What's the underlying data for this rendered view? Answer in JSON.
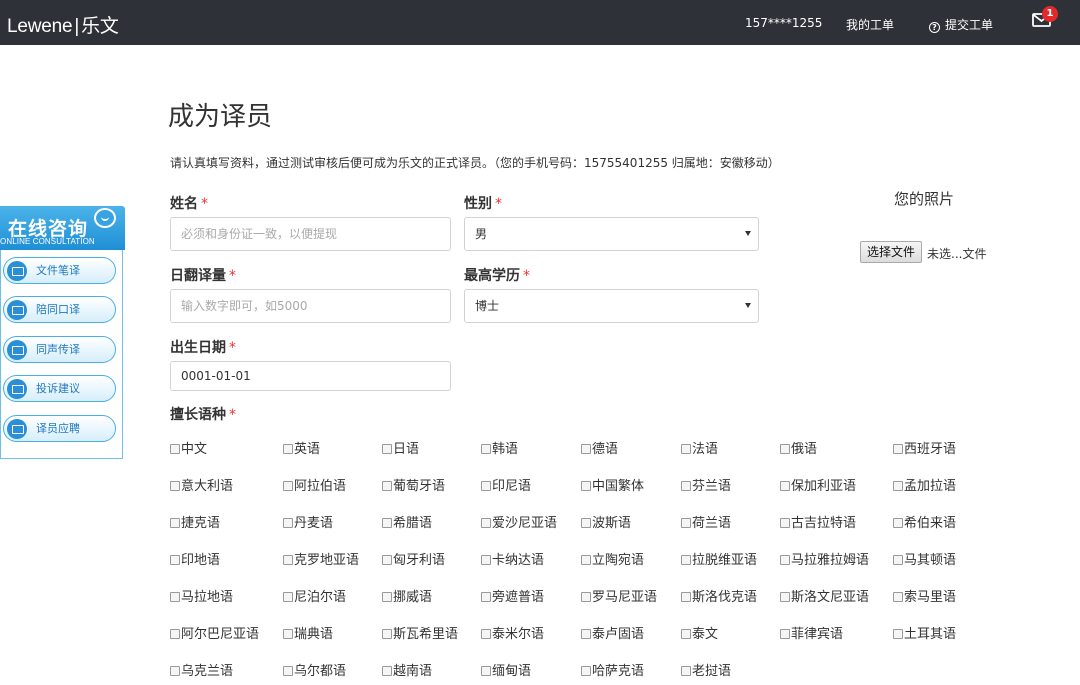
{
  "header": {
    "brand_en": "Lewene",
    "brand_sep": "|",
    "brand_cn": "乐文",
    "phone": "157****1255",
    "my_orders": "我的工单",
    "submit_order": "提交工单",
    "help_icon": "question-circle-icon",
    "mail_icon": "mail-icon",
    "notification_count": "1"
  },
  "page": {
    "title": "成为译员",
    "intro": "请认真填写资料，通过测试审核后便可成为乐文的正式译员。（您的手机号码：15755401255   归属地：安徽移动）"
  },
  "form": {
    "required_mark": "*",
    "name": {
      "label": "姓名",
      "placeholder": "必须和身份证一致，以便提现",
      "value": ""
    },
    "gender": {
      "label": "性别",
      "selected": "男"
    },
    "daily": {
      "label": "日翻译量",
      "placeholder": "输入数字即可，如5000",
      "value": ""
    },
    "education": {
      "label": "最高学历",
      "selected": "博士"
    },
    "birth": {
      "label": "出生日期",
      "value": "0001-01-01"
    },
    "languages_label": "擅长语种",
    "photo": {
      "title": "您的照片",
      "button": "选择文件",
      "status": "未选...文件"
    }
  },
  "languages": [
    "中文",
    "英语",
    "日语",
    "韩语",
    "德语",
    "法语",
    "俄语",
    "西班牙语",
    "意大利语",
    "阿拉伯语",
    "葡萄牙语",
    "印尼语",
    "中国繁体",
    "芬兰语",
    "保加利亚语",
    "孟加拉语",
    "捷克语",
    "丹麦语",
    "希腊语",
    "爱沙尼亚语",
    "波斯语",
    "荷兰语",
    "古吉拉特语",
    "希伯来语",
    "印地语",
    "克罗地亚语",
    "匈牙利语",
    "卡纳达语",
    "立陶宛语",
    "拉脱维亚语",
    "马拉雅拉姆语",
    "马其顿语",
    "马拉地语",
    "尼泊尔语",
    "挪威语",
    "旁遮普语",
    "罗马尼亚语",
    "斯洛伐克语",
    "斯洛文尼亚语",
    "索马里语",
    "阿尔巴尼亚语",
    "瑞典语",
    "斯瓦希里语",
    "泰米尔语",
    "泰卢固语",
    "泰文",
    "菲律宾语",
    "土耳其语",
    "乌克兰语",
    "乌尔都语",
    "越南语",
    "缅甸语",
    "哈萨克语",
    "老挝语"
  ],
  "side_widget": {
    "title_cn": "在线咨询",
    "title_en": "ONLINE CONSULTATION",
    "items": [
      "文件笔译",
      "陪同口译",
      "同声传译",
      "投诉建议",
      "译员应聘"
    ]
  },
  "colors": {
    "topbar": "#2f3138",
    "accent": "#1f8fd6",
    "required": "#e33333",
    "badge": "#e12b2b"
  }
}
